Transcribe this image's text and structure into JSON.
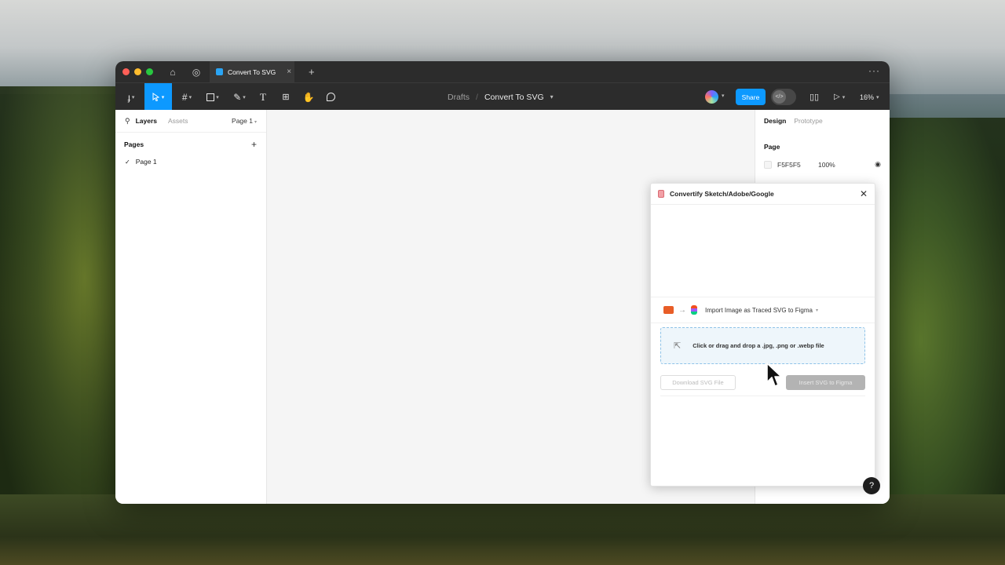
{
  "titlebar": {
    "tab_label": "Convert To SVG",
    "tab_close": "×",
    "new_tab": "+",
    "more": "···"
  },
  "toolbar": {
    "breadcrumb_parent": "Drafts",
    "breadcrumb_sep": "/",
    "file_name": "Convert To SVG",
    "share_label": "Share",
    "zoom": "16%"
  },
  "left_panel": {
    "tab_layers": "Layers",
    "tab_assets": "Assets",
    "current_page": "Page 1",
    "pages_title": "Pages",
    "add": "+",
    "pages": [
      {
        "label": "Page 1",
        "selected": true
      }
    ]
  },
  "right_panel": {
    "tab_design": "Design",
    "tab_prototype": "Prototype",
    "section_title": "Page",
    "fill_hex": "F5F5F5",
    "fill_opacity": "100%",
    "fill_color": "#F5F5F5"
  },
  "plugin": {
    "title": "Convertify Sketch/Adobe/Google",
    "close": "✕",
    "mode_label": "Import Image as Traced SVG to Figma",
    "drop_label": "Click or drag and drop a .jpg, .png or .webp file",
    "download_label": "Download SVG File",
    "insert_label": "Insert SVG to Figma"
  },
  "help": "?",
  "colors": {
    "accent": "#0d99ff",
    "toolbar_bg": "#2c2c2c",
    "canvas_bg": "#f5f5f5"
  },
  "icons": [
    "home-icon",
    "globe-icon",
    "figma-menu-icon",
    "move-tool-icon",
    "frame-tool-icon",
    "shape-tool-icon",
    "pen-tool-icon",
    "text-tool-icon",
    "resources-icon",
    "hand-tool-icon",
    "comment-icon",
    "book-icon",
    "play-icon",
    "search-icon",
    "check-icon",
    "eye-icon",
    "close-icon",
    "image-import-icon",
    "cursor-icon"
  ]
}
